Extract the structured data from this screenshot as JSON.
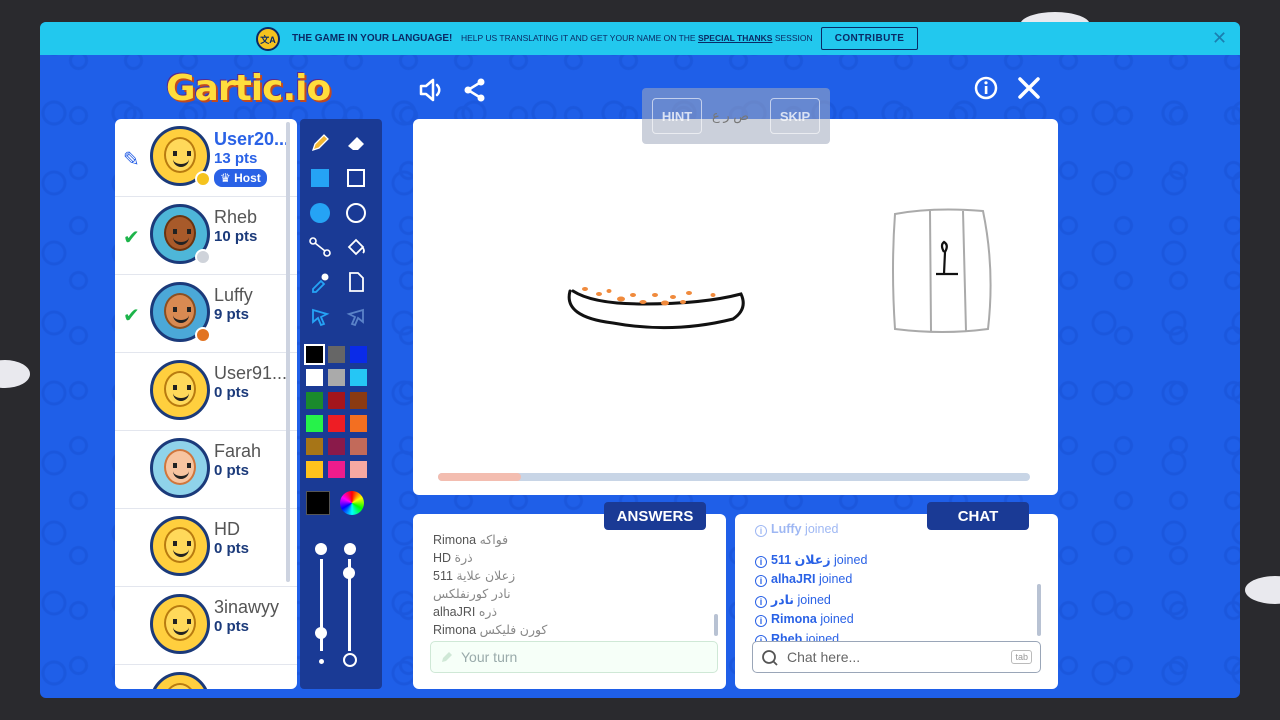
{
  "banner": {
    "headline": "THE GAME IN YOUR LANGUAGE!",
    "text_before": "HELP US TRANSLATING IT AND GET YOUR NAME ON THE",
    "link": "SPECIAL THANKS",
    "text_after": "SESSION",
    "contribute_label": "CONTRIBUTE",
    "close_label": "✕",
    "lang_icon_label": "文A"
  },
  "logo": "Gartic.io",
  "top_icons": {
    "sound": "🔈",
    "share": "⋈",
    "info": "ⓘ",
    "close": "✕"
  },
  "players": [
    {
      "name": "User20...",
      "points": "13 pts",
      "mark": "✎",
      "host_label": "Host",
      "status_color": "#f5c31e",
      "me": true
    },
    {
      "name": "Rheb",
      "points": "10 pts",
      "mark": "✔",
      "status_color": "#cfd3da"
    },
    {
      "name": "Luffy",
      "points": "9 pts",
      "mark": "✔",
      "status_color": "#e27422"
    },
    {
      "name": "User91...",
      "points": "0 pts"
    },
    {
      "name": "Farah",
      "points": "0 pts"
    },
    {
      "name": "HD",
      "points": "0 pts"
    },
    {
      "name": "3inawyy",
      "points": "0 pts"
    }
  ],
  "tools": {
    "icons": [
      "pencil-icon",
      "eraser-icon",
      "square-fill-icon",
      "square-outline-icon",
      "circle-fill-icon",
      "circle-outline-icon",
      "line-icon",
      "bucket-icon",
      "eyedropper-icon",
      "page-icon",
      "undo-icon",
      "redo-icon"
    ],
    "palette": [
      "#000000",
      "#666666",
      "#0a2be8",
      "#ffffff",
      "#aaaaaa",
      "#25c6f5",
      "#1a8a2c",
      "#a3151c",
      "#8a3a12",
      "#26f24a",
      "#ee1d24",
      "#f36f21",
      "#a77517",
      "#8a1a4a",
      "#c26a5a",
      "#ffc21c",
      "#ee1c8c",
      "#f7a9a2"
    ],
    "current_color": "#000000",
    "selected_swatch": 0
  },
  "hint": {
    "hint_label": "HINT",
    "skip_label": "SKIP",
    "word": "ص ر ع"
  },
  "timer_progress": 0.14,
  "answers": {
    "tag": "ANSWERS",
    "lines": [
      {
        "user": "Rimona",
        "guess": "فواكه"
      },
      {
        "user": "HD",
        "guess": "ذرة"
      },
      {
        "user": "511",
        "guess": "زعلان علاية"
      },
      {
        "user": "",
        "guess": "نادر كورنفلكس"
      },
      {
        "user": "alhaJRI",
        "guess": "ذره"
      },
      {
        "user": "Rimona",
        "guess": "كورن فليكس"
      }
    ],
    "placeholder": "Your turn"
  },
  "chat": {
    "tag": "CHAT",
    "lines": [
      {
        "user": "Luffy",
        "text": "joined"
      },
      {
        "user": "511 زعلان",
        "text": "joined"
      },
      {
        "user": "alhaJRI",
        "text": "joined"
      },
      {
        "user": "نادر",
        "text": "joined"
      },
      {
        "user": "Rimona",
        "text": "joined"
      },
      {
        "user": "Rheb",
        "text": "joined"
      }
    ],
    "placeholder": "Chat here...",
    "tab_key": "tab"
  }
}
